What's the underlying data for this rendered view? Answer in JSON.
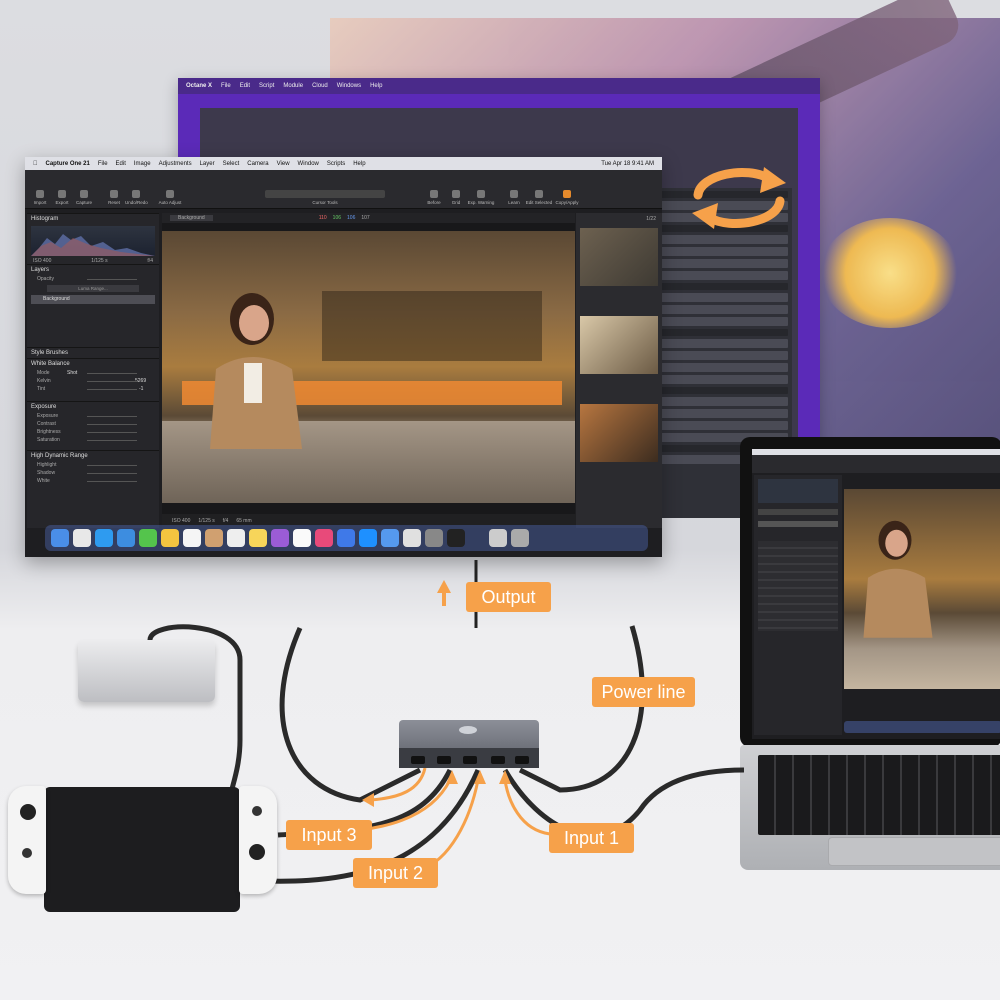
{
  "labels": {
    "output": "Output",
    "power_line": "Power line",
    "input1": "Input 1",
    "input2": "Input 2",
    "input3": "Input 3"
  },
  "octane_window": {
    "menu": [
      "Octane X",
      "File",
      "Edit",
      "Script",
      "Module",
      "Cloud",
      "Windows",
      "Help"
    ]
  },
  "capture_one": {
    "menu": [
      "Capture One 21",
      "File",
      "Edit",
      "Image",
      "Adjustments",
      "Layer",
      "Select",
      "Camera",
      "View",
      "Window",
      "Scripts",
      "Help"
    ],
    "clock": "Tue Apr 18 9:41 AM",
    "toolbar": [
      "Import",
      "Export",
      "Capture",
      "Reset",
      "Undo/Redo",
      "Auto Adjust",
      "Cursor Tools",
      "Before",
      "Grid",
      "Exp. Warning",
      "Learn",
      "Edit Selected",
      "Copy/Apply"
    ],
    "panels": {
      "histogram": "Histogram",
      "histo_info": [
        "ISO 400",
        "1/125 s",
        "f/4"
      ],
      "layers": "Layers",
      "opacity": "Opacity",
      "luma_range": "Luma Range...",
      "background": "Background",
      "style_brushes": "Style Brushes",
      "white_balance": "White Balance",
      "wb_rows": [
        "Mode",
        "Kelvin",
        "Tint"
      ],
      "mode_value": "Shot",
      "kelvin_value": "5269",
      "tint_value": "-1",
      "exposure": "Exposure",
      "exposure_rows": [
        "Exposure",
        "Contrast",
        "Brightness",
        "Saturation"
      ],
      "hdr": "High Dynamic Range",
      "hdr_rows": [
        "Highlight",
        "Shadow",
        "White"
      ]
    },
    "viewer": {
      "layer_select": "Background",
      "rgb": [
        "110",
        "106",
        "106",
        "107"
      ],
      "page": "1/22",
      "footer": [
        "ISO 400",
        "1/125 s",
        "f/4",
        "65 mm"
      ]
    }
  },
  "colors": {
    "accent": "#f6a14a",
    "octane_purple": "#5b2ab8"
  },
  "icons": [
    "sync-icon",
    "arrow-up-icon"
  ]
}
